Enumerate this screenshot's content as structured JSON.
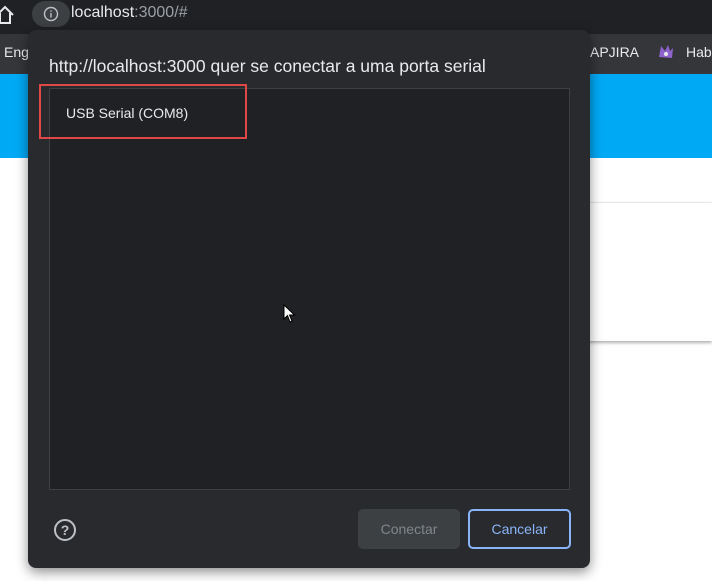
{
  "browser": {
    "url_host": "localhost",
    "url_rest": ":3000/#",
    "bookmarks": {
      "left": "Eng",
      "right1": "APJIRA",
      "right2": "Hab"
    }
  },
  "dialog": {
    "title": "http://localhost:3000 quer se conectar a uma porta serial",
    "devices": [
      "USB Serial (COM8)"
    ],
    "connect_label": "Conectar",
    "cancel_label": "Cancelar",
    "help_symbol": "?"
  },
  "colors": {
    "page_header": "#00a9f4",
    "dialog_bg": "#292a2d",
    "accent": "#8ab4f8",
    "highlight": "#e04848"
  }
}
